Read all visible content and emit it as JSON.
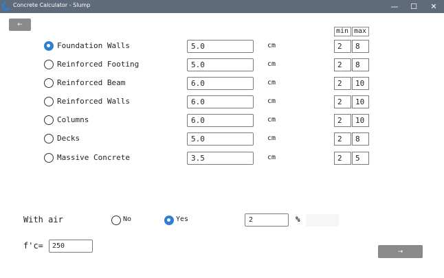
{
  "window": {
    "title": "Concrete Calculator - Slump",
    "minimize": "—",
    "maximize": "☐",
    "close": "✕",
    "icon": "app-logo-icon",
    "accent": "#2f7fd1"
  },
  "nav": {
    "back_label": "←",
    "next_label": "→"
  },
  "table": {
    "min_header": "min",
    "max_header": "max"
  },
  "rows": [
    {
      "label": "Foundation Walls",
      "value": "5.0",
      "unit": "cm",
      "min": "2",
      "max": "8",
      "selected": true
    },
    {
      "label": "Reinforced Footing",
      "value": "5.0",
      "unit": "cm",
      "min": "2",
      "max": "8",
      "selected": false
    },
    {
      "label": "Reinforced Beam",
      "value": "6.0",
      "unit": "cm",
      "min": "2",
      "max": "10",
      "selected": false
    },
    {
      "label": "Reinforced Walls",
      "value": "6.0",
      "unit": "cm",
      "min": "2",
      "max": "10",
      "selected": false
    },
    {
      "label": "Columns",
      "value": "6.0",
      "unit": "cm",
      "min": "2",
      "max": "10",
      "selected": false
    },
    {
      "label": "Decks",
      "value": "5.0",
      "unit": "cm",
      "min": "2",
      "max": "8",
      "selected": false
    },
    {
      "label": "Massive Concrete",
      "value": "3.5",
      "unit": "cm",
      "min": "2",
      "max": "5",
      "selected": false
    }
  ],
  "air": {
    "label": "With air",
    "no_label": "No",
    "yes_label": "Yes",
    "selected": "Yes",
    "value": "2",
    "unit": "%"
  },
  "strength": {
    "label": "f'c=",
    "value": "250"
  }
}
